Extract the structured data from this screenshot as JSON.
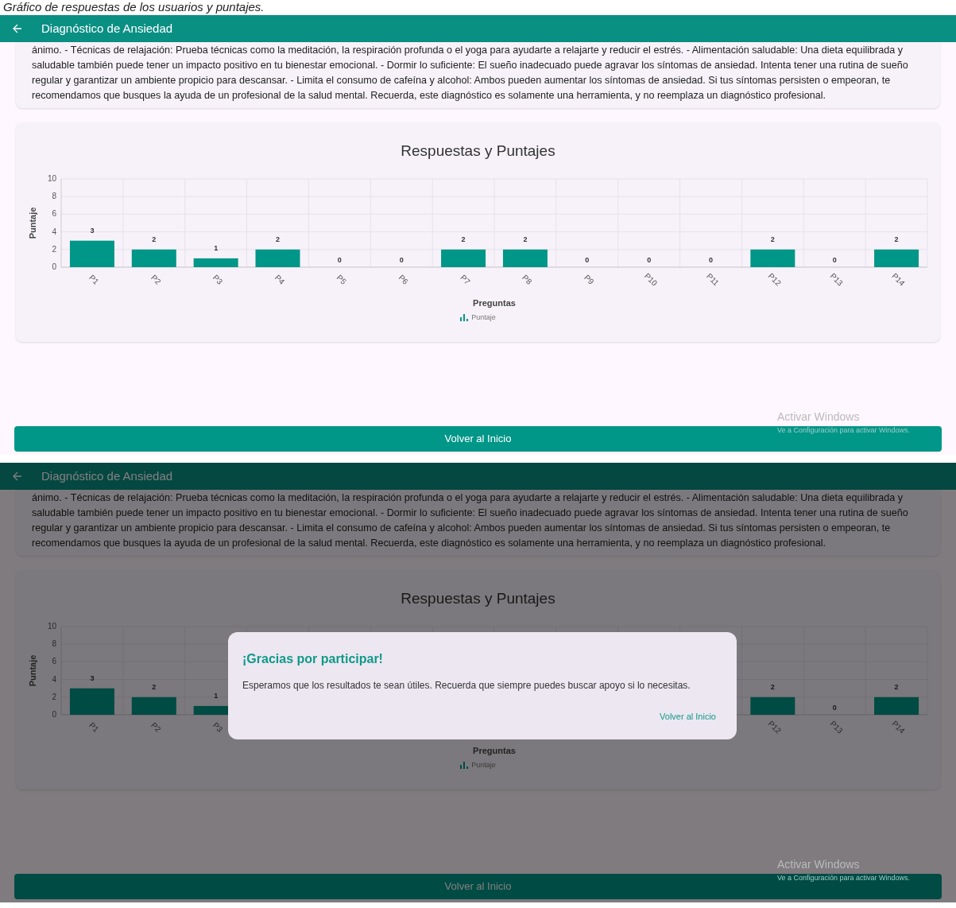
{
  "caption": "Gráfico de respuestas de los usuarios y puntajes.",
  "screens": [
    {
      "app_bar": {
        "title": "Diagnóstico de Ansiedad"
      },
      "recommendations": "ánimo. - Técnicas de relajación: Prueba técnicas como la meditación, la respiración profunda o el yoga para ayudarte a relajarte y reducir el estrés. - Alimentación saludable: Una dieta equilibrada y saludable también puede tener un impacto positivo en tu bienestar emocional. - Dormir lo suficiente: El sueño inadecuado puede agravar los síntomas de ansiedad. Intenta tener una rutina de sueño regular y garantizar un ambiente propicio para descansar. - Limita el consumo de cafeína y alcohol: Ambos pueden aumentar los síntomas de ansiedad. Si tus síntomas persisten o empeoran, te recomendamos que busques la ayuda de un profesional de la salud mental. Recuerda, este diagnóstico es solamente una herramienta, y no reemplaza un diagnóstico profesional.",
      "chart_data": {
        "type": "bar",
        "title": "Respuestas y Puntajes",
        "xlabel": "Preguntas",
        "ylabel": "Puntaje",
        "categories": [
          "P1",
          "P2",
          "P3",
          "P4",
          "P5",
          "P6",
          "P7",
          "P8",
          "P9",
          "P10",
          "P11",
          "P12",
          "P13",
          "P14"
        ],
        "series": [
          {
            "name": "Puntaje",
            "color": "#009688",
            "values": [
              3,
              2,
              1,
              2,
              0,
              0,
              2,
              2,
              0,
              0,
              0,
              2,
              0,
              2
            ]
          }
        ],
        "ylim": [
          0,
          10
        ],
        "yticks": [
          0,
          2,
          4,
          6,
          8,
          10
        ],
        "grid": true,
        "data_labels": true
      },
      "watermark": {
        "title": "Activar Windows",
        "subtitle": "Ve a Configuración para activar Windows."
      },
      "button": "Volver al Inicio"
    },
    {
      "dimmed": true,
      "app_bar": {
        "title": "Diagnóstico de Ansiedad"
      },
      "recommendations": "ánimo. - Técnicas de relajación: Prueba técnicas como la meditación, la respiración profunda o el yoga para ayudarte a relajarte y reducir el estrés. - Alimentación saludable: Una dieta equilibrada y saludable también puede tener un impacto positivo en tu bienestar emocional. - Dormir lo suficiente: El sueño inadecuado puede agravar los síntomas de ansiedad. Intenta tener una rutina de sueño regular y garantizar un ambiente propicio para descansar. - Limita el consumo de cafeína y alcohol: Ambos pueden aumentar los síntomas de ansiedad. Si tus síntomas persisten o empeoran, te recomendamos que busques la ayuda de un profesional de la salud mental. Recuerda, este diagnóstico es solamente una herramienta, y no reemplaza un diagnóstico profesional.",
      "chart_data": {
        "type": "bar",
        "title": "Respuestas y Puntajes",
        "xlabel": "Preguntas",
        "ylabel": "Puntaje",
        "categories": [
          "P1",
          "P2",
          "P3",
          null,
          null,
          null,
          null,
          null,
          null,
          null,
          null,
          "P12",
          "P13",
          "P14"
        ],
        "series": [
          {
            "name": "Puntaje",
            "color": "#009688",
            "values": [
              3,
              2,
              1,
              null,
              null,
              null,
              null,
              null,
              null,
              null,
              null,
              2,
              0,
              2
            ]
          }
        ],
        "ylim": [
          0,
          10
        ],
        "yticks": [
          0,
          2,
          4,
          6,
          8,
          10
        ],
        "grid": true,
        "data_labels": true
      },
      "watermark": {
        "title": "Activar Windows",
        "subtitle": "Ve a Configuración para activar Windows."
      },
      "button": "Volver al Inicio",
      "dialog": {
        "title": "¡Gracias por participar!",
        "message": "Esperamos que los resultados te sean útiles. Recuerda que siempre puedes buscar apoyo si lo necesitas.",
        "action": "Volver al Inicio"
      }
    }
  ]
}
